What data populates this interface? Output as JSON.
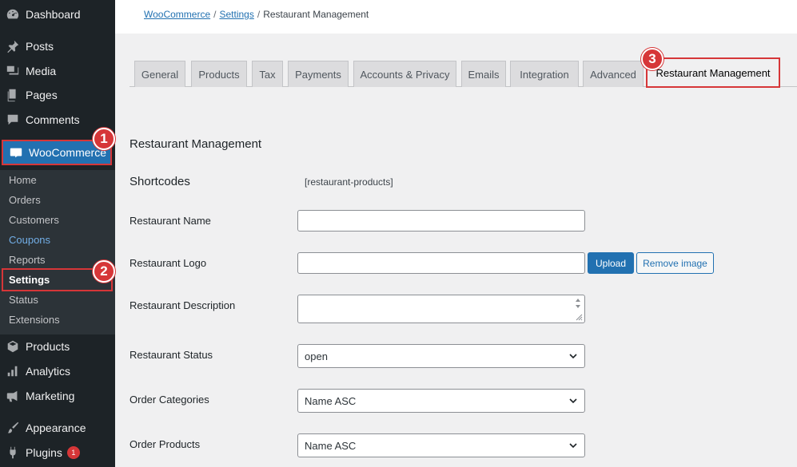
{
  "sidebar": {
    "items": [
      {
        "label": "Dashboard",
        "icon": "dashboard-icon"
      },
      {
        "label": "Posts",
        "icon": "pin-icon"
      },
      {
        "label": "Media",
        "icon": "media-icon"
      },
      {
        "label": "Pages",
        "icon": "pages-icon"
      },
      {
        "label": "Comments",
        "icon": "comment-icon"
      },
      {
        "label": "WooCommerce",
        "icon": "woo-icon"
      },
      {
        "label": "Products",
        "icon": "box-icon"
      },
      {
        "label": "Analytics",
        "icon": "bar-chart-icon"
      },
      {
        "label": "Marketing",
        "icon": "megaphone-icon"
      },
      {
        "label": "Appearance",
        "icon": "brush-icon"
      },
      {
        "label": "Plugins",
        "icon": "plug-icon",
        "badge": "1"
      }
    ],
    "submenu": [
      "Home",
      "Orders",
      "Customers",
      "Coupons",
      "Reports",
      "Settings",
      "Status",
      "Extensions"
    ]
  },
  "steps": [
    "1",
    "2",
    "3"
  ],
  "breadcrumb": {
    "woocommerce": "WooCommerce",
    "separator": "/",
    "settings": "Settings",
    "current": "Restaurant Management"
  },
  "tabs": [
    "General",
    "Products",
    "Tax",
    "Payments",
    "Accounts & Privacy",
    "Emails",
    "Integration",
    "Advanced",
    "Restaurant Management"
  ],
  "form": {
    "section_title": "Restaurant Management",
    "shortcodes_label": "Shortcodes",
    "shortcode_value": "[restaurant-products]",
    "name_label": "Restaurant Name",
    "name_value": "",
    "logo_label": "Restaurant Logo",
    "logo_value": "",
    "upload_label": "Upload",
    "remove_label": "Remove image",
    "description_label": "Restaurant Description",
    "status_label": "Restaurant Status",
    "status_value": "open",
    "categories_label": "Order Categories",
    "categories_value": "Name ASC",
    "products_label": "Order Products",
    "products_value": "Name ASC"
  },
  "colors": {
    "sidebar_bg": "#1d2327",
    "accent": "#2271b1",
    "highlight": "#d63638"
  }
}
